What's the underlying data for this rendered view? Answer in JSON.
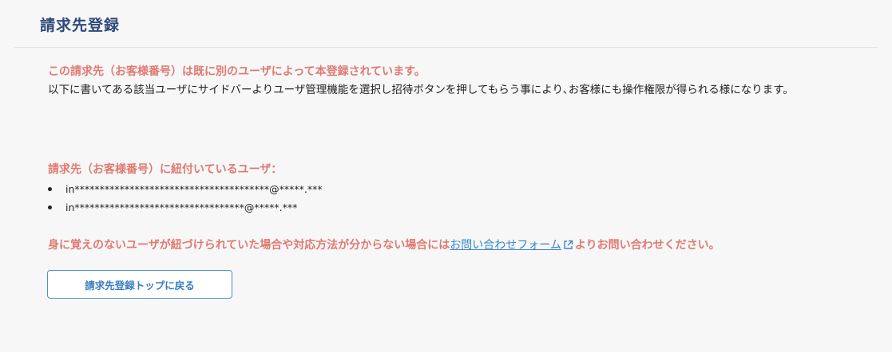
{
  "header": {
    "title": "請求先登録"
  },
  "message": {
    "warning": "この請求先（お客様番号）は既に別のユーザによって本登録されています。",
    "body": "以下に書いてある該当ユーザにサイドバーよりユーザ管理機能を選択し招待ボタンを押してもらう事により､お客様にも操作権限が得られる様になります。"
  },
  "linked_users": {
    "heading": "請求先（お客様番号）に紐付いているユーザ：",
    "users": [
      "in***************************************@*****.***",
      "in**********************************@*****.***"
    ]
  },
  "notice": {
    "text_before": "身に覚えのないユーザが紐づけられていた場合や対応方法が分からない場合には",
    "link_text": "お問い合わせフォーム",
    "text_after": "よりお問い合わせください。"
  },
  "actions": {
    "back_label": "請求先登録トップに戻る"
  },
  "colors": {
    "title": "#2e4a7a",
    "warning": "#e07a70",
    "link": "#3a86c8",
    "button_border": "#4a8fd0"
  }
}
